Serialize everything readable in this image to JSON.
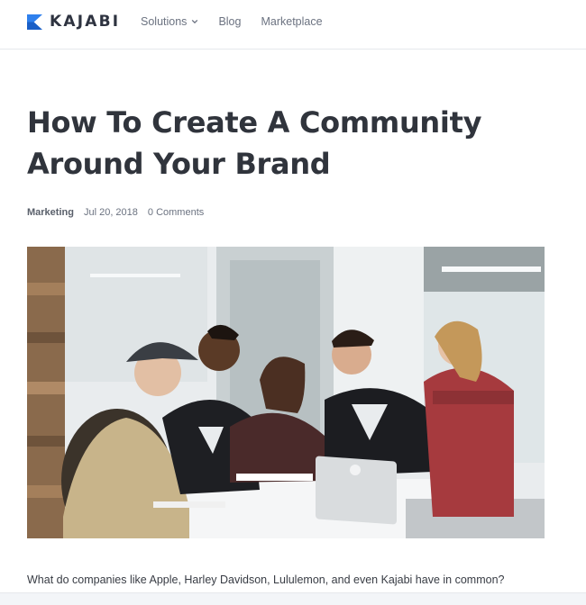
{
  "brand": {
    "name": "KAJABI",
    "accent": "#2f80ed"
  },
  "nav": {
    "solutions_label": "Solutions",
    "blog_label": "Blog",
    "marketplace_label": "Marketplace"
  },
  "article": {
    "title_line1": "How To Create A Community",
    "title_line2": "Around Your Brand",
    "category": "Marketing",
    "date": "Jul 20, 2018",
    "comments": "0 Comments",
    "hero_image": "team-around-laptop-photo",
    "intro": "What do companies like Apple, Harley Davidson, Lululemon, and even Kajabi have in common?"
  }
}
